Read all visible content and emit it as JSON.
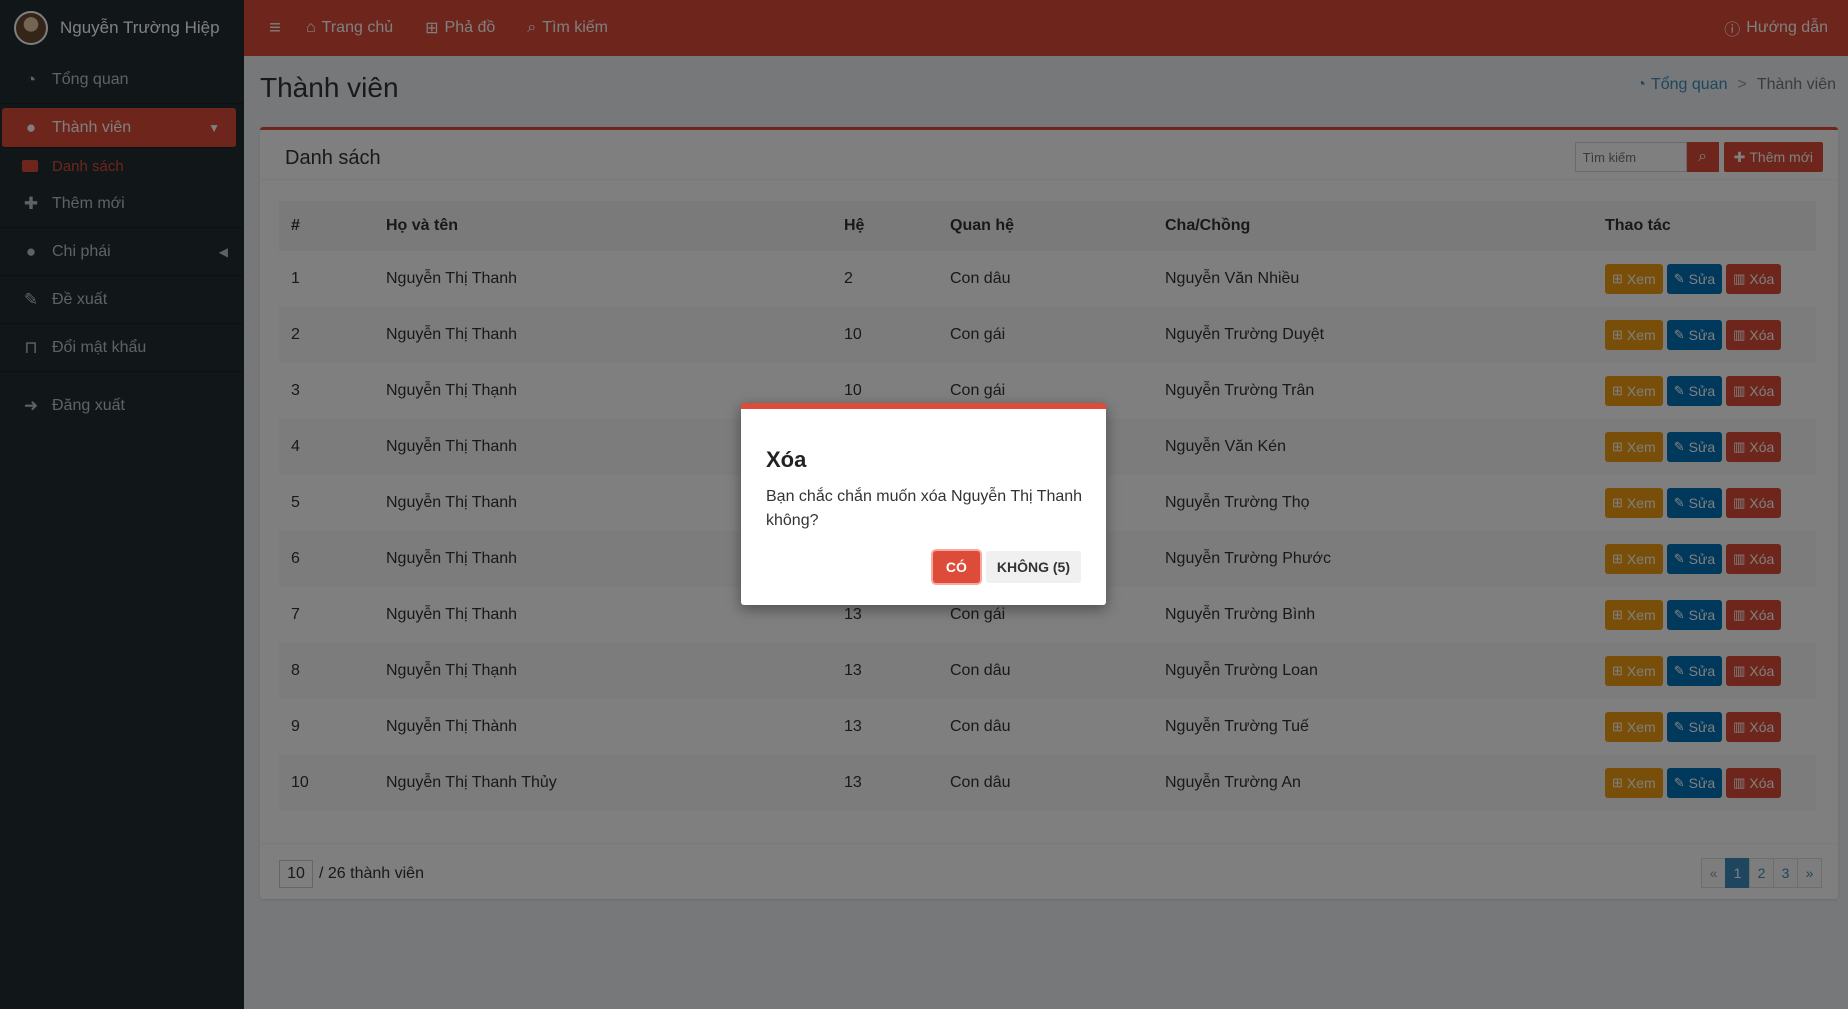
{
  "user": {
    "name": "Nguyễn Trường Hiệp"
  },
  "sidebar": {
    "items": [
      {
        "label": "Tổng quan",
        "icon": "dashboard-icon"
      },
      {
        "label": "Thành viên",
        "icon": "user-icon"
      },
      {
        "label": "Danh sách",
        "icon": "list-icon"
      },
      {
        "label": "Thêm mới",
        "icon": "user-plus-icon"
      },
      {
        "label": "Chi phái",
        "icon": "users-icon"
      },
      {
        "label": "Đề xuất",
        "icon": "user-edit-icon"
      },
      {
        "label": "Đổi mật khẩu",
        "icon": "lock-icon"
      },
      {
        "label": "Đăng xuất",
        "icon": "sign-out-icon"
      }
    ]
  },
  "header": {
    "links": [
      "Trang chủ",
      "Phả đồ",
      "Tìm kiếm"
    ],
    "help": "Hướng dẫn"
  },
  "page": {
    "title": "Thành viên"
  },
  "breadcrumb": {
    "home": "Tổng quan",
    "sep": ">",
    "current": "Thành viên"
  },
  "box": {
    "title": "Danh sách",
    "search_placeholder": "Tìm kiếm",
    "add_label": "Thêm mới"
  },
  "table": {
    "headers": [
      "#",
      "Họ và tên",
      "Hệ",
      "Quan hệ",
      "Cha/Chồng",
      "Thao tác"
    ],
    "actions": {
      "view": "Xem",
      "edit": "Sửa",
      "delete": "Xóa"
    },
    "rows": [
      [
        "1",
        "Nguyễn Thị Thanh",
        "2",
        "Con dâu",
        "Nguyễn Văn Nhiều"
      ],
      [
        "2",
        "Nguyễn Thị Thanh",
        "10",
        "Con gái",
        "Nguyễn Trường Duyệt"
      ],
      [
        "3",
        "Nguyễn Thị Thạnh",
        "10",
        "Con gái",
        "Nguyễn Trường Trân"
      ],
      [
        "4",
        "Nguyễn Thị Thanh",
        "",
        "",
        "Nguyễn Văn Kén"
      ],
      [
        "5",
        "Nguyễn Thị Thanh",
        "",
        "",
        "Nguyễn Trường Thọ"
      ],
      [
        "6",
        "Nguyễn Thị Thanh",
        "",
        "",
        "Nguyễn Trường Phước"
      ],
      [
        "7",
        "Nguyễn Thị Thanh",
        "13",
        "Con gái",
        "Nguyễn Trường Bình"
      ],
      [
        "8",
        "Nguyễn Thị Thạnh",
        "13",
        "Con dâu",
        "Nguyễn Trường Loan"
      ],
      [
        "9",
        "Nguyễn Thị Thành",
        "13",
        "Con dâu",
        "Nguyễn Trường Tuế"
      ],
      [
        "10",
        "Nguyễn Thị Thanh Thủy",
        "13",
        "Con dâu",
        "Nguyễn Trường An"
      ]
    ]
  },
  "footer": {
    "per_page": "10",
    "total_text": "/ 26 thành viên",
    "pages": [
      "«",
      "1",
      "2",
      "3",
      "»"
    ],
    "current_page": "1"
  },
  "modal": {
    "title": "Xóa",
    "message": "Bạn chắc chắn muốn xóa Nguyễn Thị Thanh không?",
    "yes": "CÓ",
    "no": "KHÔNG (5)"
  },
  "colors": {
    "accent": "#dd4b39",
    "sidebar_bg": "#222d32",
    "view_btn": "#f39c12",
    "edit_btn": "#0073b7",
    "link": "#3c8dbc"
  }
}
